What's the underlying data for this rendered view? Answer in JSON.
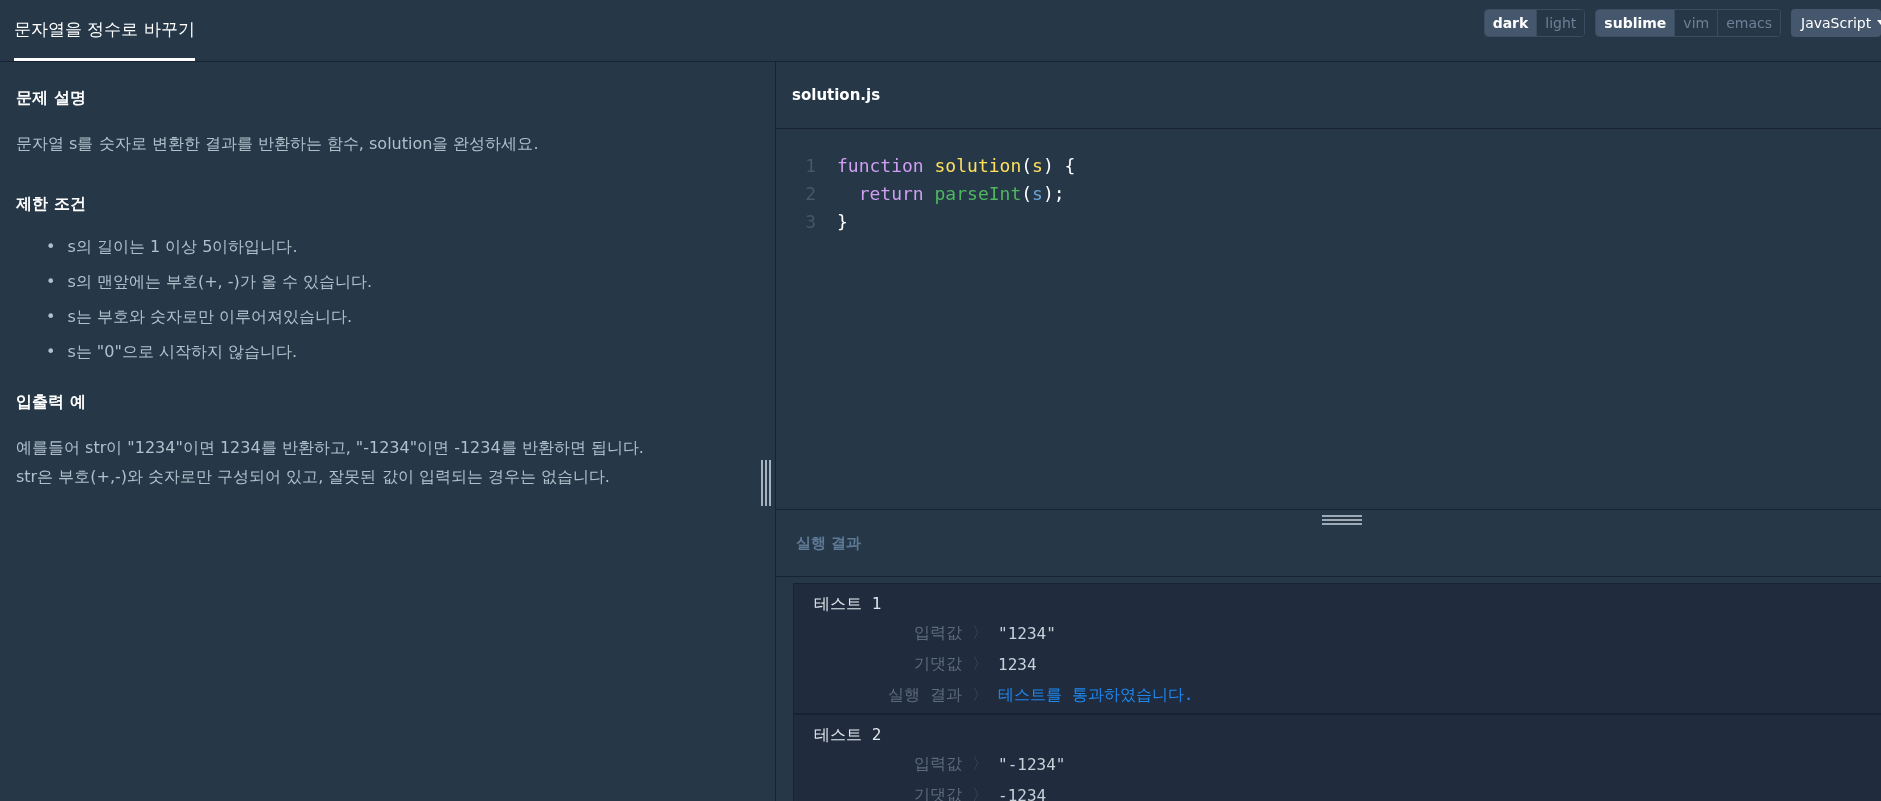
{
  "header": {
    "tabs": [
      {
        "label": "문자열을 정수로 바꾸기",
        "selected": true
      }
    ],
    "theme_options": [
      {
        "label": "dark",
        "selected": true
      },
      {
        "label": "light",
        "selected": false
      }
    ],
    "keymap_options": [
      {
        "label": "sublime",
        "selected": true
      },
      {
        "label": "vim",
        "selected": false
      },
      {
        "label": "emacs",
        "selected": false
      }
    ],
    "language": {
      "value": "JavaScript"
    }
  },
  "problem": {
    "sections": [
      {
        "title": "문제 설명",
        "kind": "paragraph",
        "lines": [
          "문자열 s를 숫자로 변환한 결과를 반환하는 함수, solution을 완성하세요."
        ]
      },
      {
        "title": "제한 조건",
        "kind": "bullets",
        "marker": "•",
        "lines": [
          "s의 길이는 1 이상 5이하입니다.",
          "s의 맨앞에는 부호(+, -)가 올 수 있습니다.",
          "s는 부호와 숫자로만 이루어져있습니다.",
          "s는 \"0\"으로 시작하지 않습니다."
        ]
      },
      {
        "title": "입출력 예",
        "kind": "paragraph",
        "lines": [
          "예를들어 str이 \"1234\"이면 1234를 반환하고, \"-1234\"이면 -1234를 반환하면 됩니다.",
          "str은 부호(+,-)와 숫자로만 구성되어 있고, 잘못된 값이 입력되는 경우는 없습니다."
        ]
      }
    ]
  },
  "editor": {
    "filename": "solution.js",
    "lines": [
      {
        "number": "1",
        "indented": false,
        "tokens": [
          {
            "kind": "keyword",
            "text": "function"
          },
          {
            "kind": "def",
            "text": "solution",
            "space": true
          },
          {
            "kind": "punct",
            "text": "("
          },
          {
            "kind": "param",
            "text": "s"
          },
          {
            "kind": "punct",
            "text": ")"
          },
          {
            "kind": "punct",
            "text": "{",
            "space": true
          }
        ]
      },
      {
        "number": "2",
        "indented": true,
        "tokens": [
          {
            "kind": "keyword",
            "text": "return"
          },
          {
            "kind": "builtin",
            "text": "parseInt",
            "space": true
          },
          {
            "kind": "punct",
            "text": "("
          },
          {
            "kind": "variable",
            "text": "s"
          },
          {
            "kind": "punct",
            "text": ");"
          }
        ]
      },
      {
        "number": "3",
        "indented": false,
        "tokens": [
          {
            "kind": "punct",
            "text": "}"
          }
        ]
      }
    ]
  },
  "results": {
    "title": "실행 결과",
    "tests": [
      {
        "title": "테스트 1",
        "rows": [
          {
            "label": "입력값",
            "separator": "〉",
            "value": "\"1234\"",
            "kind": "plain"
          },
          {
            "label": "기댓값",
            "separator": "〉",
            "value": "1234",
            "kind": "plain"
          },
          {
            "label": "실행 결과",
            "separator": "〉",
            "value": "테스트를 통과하였습니다.",
            "kind": "pass"
          }
        ]
      },
      {
        "title": "테스트 2",
        "rows": [
          {
            "label": "입력값",
            "separator": "〉",
            "value": "\"-1234\"",
            "kind": "plain"
          },
          {
            "label": "기댓값",
            "separator": "〉",
            "value": "-1234",
            "kind": "plain"
          }
        ]
      }
    ]
  }
}
